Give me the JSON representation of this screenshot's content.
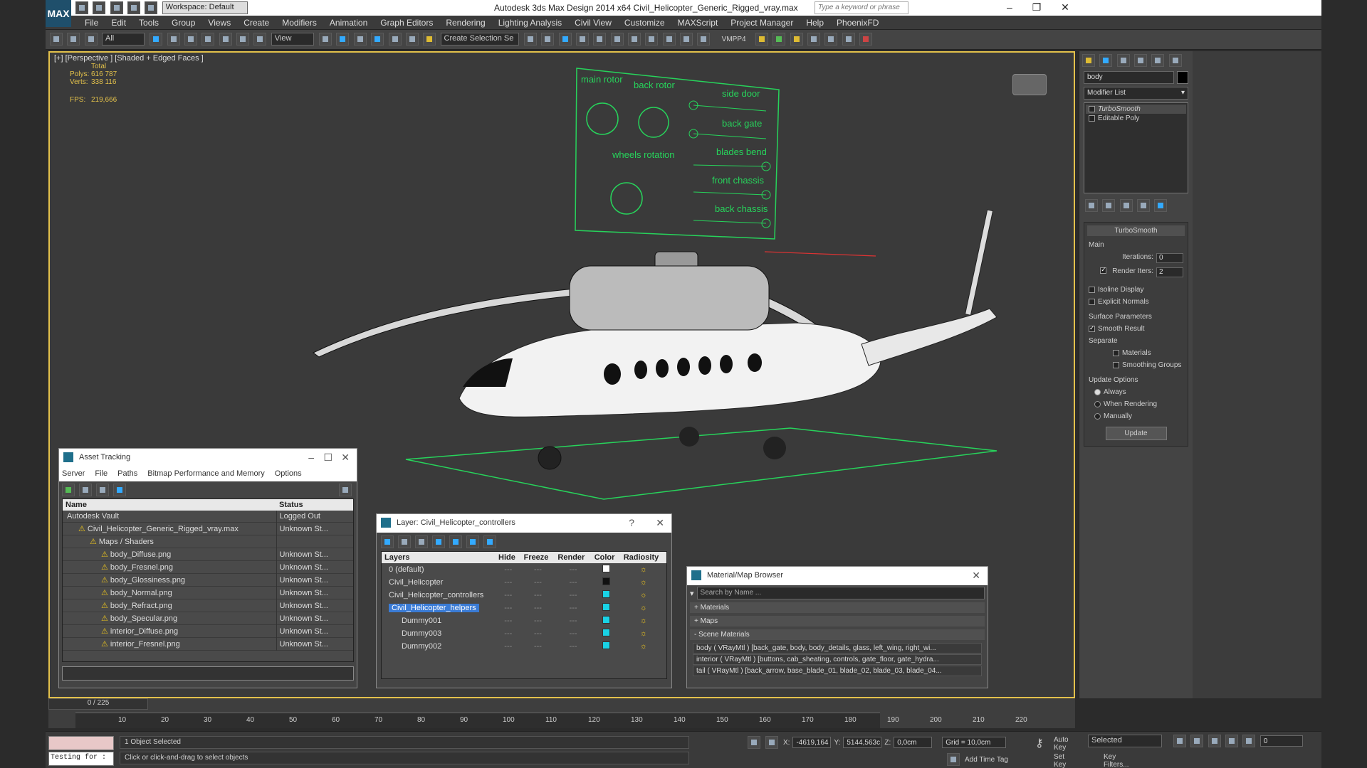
{
  "app": {
    "logo": "MAX",
    "workspace": "Workspace: Default",
    "title": "Autodesk 3ds Max Design 2014 x64      Civil_Helicopter_Generic_Rigged_vray.max",
    "search_placeholder": "Type a keyword or phrase"
  },
  "menu": [
    "File",
    "Edit",
    "Tools",
    "Group",
    "Views",
    "Create",
    "Modifiers",
    "Animation",
    "Graph Editors",
    "Rendering",
    "Lighting Analysis",
    "Civil View",
    "Customize",
    "MAXScript",
    "Project Manager",
    "Help",
    "PhoenixFD"
  ],
  "toolbar": {
    "filter": "All",
    "ref_coord": "View",
    "selection_set": "Create Selection Se",
    "vmpp": "VMPP4"
  },
  "viewport": {
    "label": "[+] [Perspective ] [Shaded + Edged Faces ]",
    "stats": {
      "total_label": "Total",
      "polys_label": "Polys:",
      "polys": "616 787",
      "verts_label": "Verts:",
      "verts": "338 116",
      "fps_label": "FPS:",
      "fps": "219,666"
    },
    "controls": {
      "main_rotor": "main rotor",
      "back_rotor": "back rotor",
      "wheels_rotation": "wheels\nrotation",
      "side_door": "side door",
      "back_gate": "back gate",
      "blades_bend": "blades bend",
      "front_chassis": "front chassis",
      "back_chassis": "back chassis"
    }
  },
  "command_panel": {
    "object_name": "body",
    "modifier_list": "Modifier List",
    "stack": [
      "TurboSmooth",
      "Editable Poly"
    ],
    "turbosmooth": {
      "title": "TurboSmooth",
      "main": "Main",
      "iterations_label": "Iterations:",
      "iterations": "0",
      "render_iters_label": "Render Iters:",
      "render_iters": "2",
      "isoline": "Isoline Display",
      "explicit": "Explicit Normals",
      "surface_params": "Surface Parameters",
      "smooth_result": "Smooth Result",
      "separate": "Separate",
      "materials": "Materials",
      "smoothing_groups": "Smoothing Groups",
      "update_options": "Update Options",
      "always": "Always",
      "when_rendering": "When Rendering",
      "manually": "Manually",
      "update_btn": "Update"
    }
  },
  "asset_tracking": {
    "title": "Asset Tracking",
    "menu": [
      "Server",
      "File",
      "Paths",
      "Bitmap Performance and Memory",
      "Options"
    ],
    "columns": [
      "Name",
      "Status"
    ],
    "rows": [
      {
        "name": "Autodesk Vault",
        "status": "Logged Out",
        "indent": 0
      },
      {
        "name": "Civil_Helicopter_Generic_Rigged_vray.max",
        "status": "Unknown St...",
        "indent": 1
      },
      {
        "name": "Maps / Shaders",
        "status": "",
        "indent": 2
      },
      {
        "name": "body_Diffuse.png",
        "status": "Unknown St...",
        "indent": 3
      },
      {
        "name": "body_Fresnel.png",
        "status": "Unknown St...",
        "indent": 3
      },
      {
        "name": "body_Glossiness.png",
        "status": "Unknown St...",
        "indent": 3
      },
      {
        "name": "body_Normal.png",
        "status": "Unknown St...",
        "indent": 3
      },
      {
        "name": "body_Refract.png",
        "status": "Unknown St...",
        "indent": 3
      },
      {
        "name": "body_Specular.png",
        "status": "Unknown St...",
        "indent": 3
      },
      {
        "name": "interior_Diffuse.png",
        "status": "Unknown St...",
        "indent": 3
      },
      {
        "name": "interior_Fresnel.png",
        "status": "Unknown St...",
        "indent": 3
      }
    ]
  },
  "layer_window": {
    "title": "Layer: Civil_Helicopter_controllers",
    "help": "?",
    "columns": [
      "Layers",
      "Hide",
      "Freeze",
      "Render",
      "Color",
      "Radiosity"
    ],
    "rows": [
      {
        "name": "0 (default)",
        "color": "#ffffff",
        "sel": false,
        "indent": 0
      },
      {
        "name": "Civil_Helicopter",
        "color": "#111111",
        "sel": false,
        "indent": 0
      },
      {
        "name": "Civil_Helicopter_controllers",
        "color": "#19d3e6",
        "sel": false,
        "indent": 0
      },
      {
        "name": "Civil_Helicopter_helpers",
        "color": "#19d3e6",
        "sel": true,
        "indent": 0
      },
      {
        "name": "Dummy001",
        "color": "#19d3e6",
        "sel": false,
        "indent": 1
      },
      {
        "name": "Dummy003",
        "color": "#19d3e6",
        "sel": false,
        "indent": 1
      },
      {
        "name": "Dummy002",
        "color": "#19d3e6",
        "sel": false,
        "indent": 1
      }
    ]
  },
  "material_browser": {
    "title": "Material/Map Browser",
    "search_placeholder": "Search by Name ...",
    "groups": [
      "+ Materials",
      "+ Maps",
      "- Scene Materials"
    ],
    "items": [
      "body ( VRayMtl ) [back_gate, body, body_details, glass, left_wing, right_wi...",
      "interior ( VRayMtl ) [buttons, cab_sheating, controls, gate_floor, gate_hydra...",
      "tail ( VRayMtl ) [back_arrow, base_blade_01, blade_02, blade_03, blade_04..."
    ]
  },
  "timeline": {
    "frame_counter": "0 / 225",
    "ticks": [
      "10",
      "20",
      "30",
      "40",
      "50",
      "60",
      "70",
      "80",
      "90",
      "100",
      "110",
      "120",
      "130",
      "140",
      "150",
      "160",
      "170",
      "180",
      "190",
      "200",
      "210",
      "220"
    ]
  },
  "status": {
    "selected": "1 Object Selected",
    "prompt": "Click or click-and-drag to select objects",
    "maxscript": "Testing for :",
    "x_label": "X:",
    "x": "-4619,164",
    "y_label": "Y:",
    "y": "5144,563c",
    "z_label": "Z:",
    "z": "0,0cm",
    "grid": "Grid = 10,0cm",
    "add_time_tag": "Add Time Tag",
    "auto_key": "Auto Key",
    "set_key": "Set Key",
    "key_mode": "Selected",
    "key_filters": "Key Filters...",
    "frame": "0"
  }
}
